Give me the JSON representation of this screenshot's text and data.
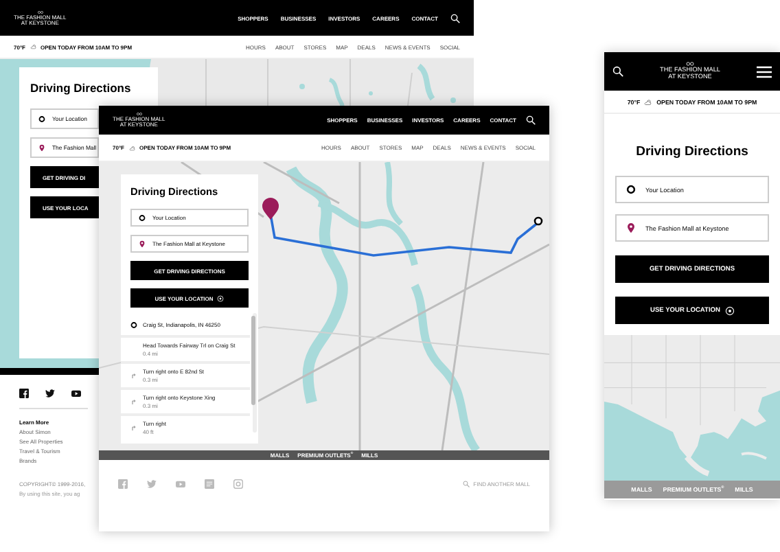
{
  "back_screen": {
    "logo": [
      "THE FASHION MALL",
      "AT KEYSTONE"
    ],
    "nav": [
      "SHOPPERS",
      "BUSINESSES",
      "INVESTORS",
      "CAREERS",
      "CONTACT"
    ],
    "info": {
      "temperature": "70°F",
      "hours": "OPEN TODAY FROM 10AM TO 9PM"
    },
    "subnav": [
      "HOURS",
      "ABOUT",
      "STORES",
      "MAP",
      "DEALS",
      "NEWS & EVENTS",
      "SOCIAL"
    ],
    "panel": {
      "title": "Driving Directions",
      "fields": [
        {
          "kind": "origin",
          "text": "Your Location"
        },
        {
          "kind": "destination",
          "text": "The Fashion Mall"
        }
      ],
      "buttons": [
        {
          "label": "GET DRIVING DI"
        },
        {
          "label": "USE YOUR LOCA"
        }
      ]
    },
    "footer": {
      "heading": "Learn More",
      "links": [
        "About Simon",
        "See All Properties",
        "Travel & Tourism",
        "Brands"
      ],
      "copyright": "COPYRIGHT© 1999-2016,",
      "terms": "By using this site, you ag"
    }
  },
  "front_screen": {
    "logo": [
      "THE FASHION MALL",
      "AT KEYSTONE"
    ],
    "nav": [
      "SHOPPERS",
      "BUSINESSES",
      "INVESTORS",
      "CAREERS",
      "CONTACT"
    ],
    "info": {
      "temperature": "70°F",
      "hours": "OPEN TODAY FROM 10AM TO 9PM"
    },
    "subnav": [
      "HOURS",
      "ABOUT",
      "STORES",
      "MAP",
      "DEALS",
      "NEWS & EVENTS",
      "SOCIAL"
    ],
    "panel": {
      "title": "Driving Directions",
      "fields": [
        {
          "kind": "origin",
          "text": "Your Location"
        },
        {
          "kind": "destination",
          "text": "The Fashion Mall at Keystone"
        }
      ],
      "buttons": [
        {
          "kind": "plain",
          "label": "GET DRIVING DIRECTIONS"
        },
        {
          "kind": "locate",
          "label": "USE YOUR LOCATION"
        }
      ],
      "route": {
        "start": "Craig St, Indianapolis, IN 46250",
        "steps": [
          {
            "kind": "straight",
            "text": "Head Towards Fairway Trl on Craig St",
            "distance": "0.4 mi"
          },
          {
            "kind": "turn",
            "text": "Turn right onto E 82nd St",
            "distance": "0.3 mi"
          },
          {
            "kind": "turn",
            "text": "Turn right onto Keystone Xing",
            "distance": "0.3 mi"
          },
          {
            "kind": "turn",
            "text": "Turn right",
            "distance": "40 ft"
          }
        ]
      }
    },
    "bottom_bar": [
      "MALLS",
      "PREMIUM OUTLETS$^{®}$",
      "MILLS"
    ],
    "footer": {
      "find_mall": "FIND ANOTHER MALL"
    }
  },
  "mobile_screen": {
    "logo": [
      "THE FASHION MALL",
      "AT KEYSTONE"
    ],
    "info": {
      "temperature": "70°F",
      "hours": "OPEN TODAY FROM 10AM TO 9PM"
    },
    "panel": {
      "title": "Driving Directions",
      "fields": [
        {
          "kind": "origin",
          "text": "Your Location"
        },
        {
          "kind": "destination",
          "text": "The Fashion Mall at Keystone"
        }
      ],
      "buttons": [
        {
          "kind": "plain",
          "label": "GET DRIVING DIRECTIONS"
        },
        {
          "kind": "locate",
          "label": "USE YOUR LOCATION"
        }
      ]
    },
    "bottom_bar": [
      "MALLS",
      "PREMIUM OUTLETS$^{®}$",
      "MILLS"
    ]
  }
}
